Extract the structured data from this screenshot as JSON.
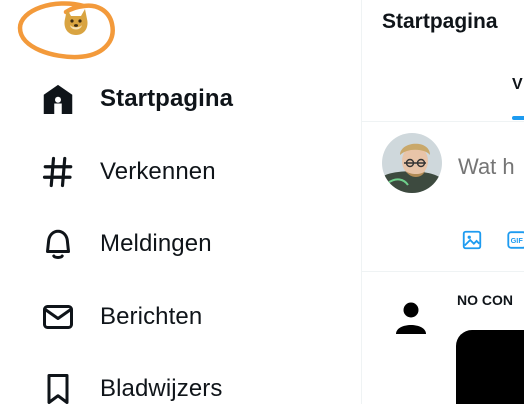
{
  "nav": {
    "items": [
      {
        "label": "Startpagina",
        "icon": "home-icon",
        "active": true
      },
      {
        "label": "Verkennen",
        "icon": "hashtag-icon",
        "active": false
      },
      {
        "label": "Meldingen",
        "icon": "bell-icon",
        "active": false
      },
      {
        "label": "Berichten",
        "icon": "envelope-icon",
        "active": false
      },
      {
        "label": "Bladwijzers",
        "icon": "bookmark-icon",
        "active": false
      }
    ]
  },
  "header": {
    "title": "Startpagina"
  },
  "tabs": [
    {
      "label": "V"
    }
  ],
  "composer": {
    "placeholder": "Wat h"
  },
  "feed": {
    "post": {
      "author": "NO CON"
    }
  },
  "colors": {
    "accent": "#1d9bf0",
    "logo_ring": "#f39a3b",
    "doge": "#d9a441",
    "text": "#0f1419",
    "muted": "#536471"
  }
}
